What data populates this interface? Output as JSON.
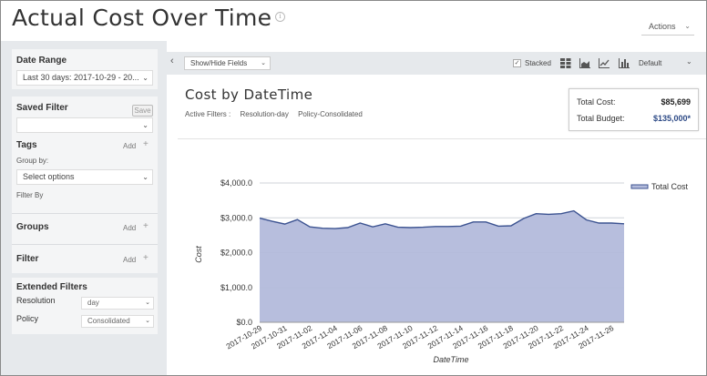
{
  "header": {
    "title": "Actual Cost Over Time",
    "actions_label": "Actions"
  },
  "sidebar": {
    "date_range": {
      "title": "Date Range",
      "value": "Last 30 days:  2017-10-29 - 20..."
    },
    "saved_filter": {
      "title": "Saved Filter",
      "save_label": "Save",
      "value": ""
    },
    "tags": {
      "title": "Tags",
      "add_label": "Add",
      "group_by_label": "Group by:",
      "select_placeholder": "Select options",
      "filter_by_label": "Filter By"
    },
    "groups": {
      "title": "Groups",
      "add_label": "Add"
    },
    "filter": {
      "title": "Filter",
      "add_label": "Add"
    },
    "extended_filters": {
      "title": "Extended Filters",
      "resolution_label": "Resolution",
      "resolution_value": "day",
      "policy_label": "Policy",
      "policy_value": "Consolidated"
    }
  },
  "toolbar": {
    "show_hide_label": "Show/Hide Fields",
    "stacked_label": "Stacked",
    "stacked_checked": true,
    "default_label": "Default"
  },
  "main": {
    "chart_title": "Cost by DateTime",
    "active_filters_label": "Active Filters :",
    "active_filters": [
      "Resolution-day",
      "Policy-Consolidated"
    ],
    "totals": {
      "cost_label": "Total Cost:",
      "cost_value": "$85,699",
      "budget_label": "Total Budget:",
      "budget_value": "$135,000*"
    }
  },
  "colors": {
    "area_fill": "#b3bbdb",
    "area_line": "#3c5391"
  },
  "chart_data": {
    "type": "area",
    "xlabel": "DateTime",
    "ylabel": "Cost",
    "ylim": [
      0,
      4000
    ],
    "yticks": [
      "$0.0",
      "$1,000.0",
      "$2,000.0",
      "$3,000.0",
      "$4,000.0"
    ],
    "grid": true,
    "legend_position": "top-right",
    "x": [
      "2017-10-29",
      "2017-10-30",
      "2017-10-31",
      "2017-11-01",
      "2017-11-02",
      "2017-11-03",
      "2017-11-04",
      "2017-11-05",
      "2017-11-06",
      "2017-11-07",
      "2017-11-08",
      "2017-11-09",
      "2017-11-10",
      "2017-11-11",
      "2017-11-12",
      "2017-11-13",
      "2017-11-14",
      "2017-11-15",
      "2017-11-16",
      "2017-11-17",
      "2017-11-18",
      "2017-11-19",
      "2017-11-20",
      "2017-11-21",
      "2017-11-22",
      "2017-11-23",
      "2017-11-24",
      "2017-11-25",
      "2017-11-26",
      "2017-11-27"
    ],
    "x_tick_labels": [
      "2017-10-29",
      "2017-10-31",
      "2017-11-02",
      "2017-11-04",
      "2017-11-06",
      "2017-11-08",
      "2017-11-10",
      "2017-11-12",
      "2017-11-14",
      "2017-11-16",
      "2017-11-18",
      "2017-11-20",
      "2017-11-22",
      "2017-11-24",
      "2017-11-26"
    ],
    "series": [
      {
        "name": "Total Cost",
        "values": [
          2990,
          2900,
          2820,
          2950,
          2740,
          2700,
          2690,
          2720,
          2850,
          2740,
          2830,
          2730,
          2720,
          2730,
          2750,
          2750,
          2760,
          2880,
          2880,
          2760,
          2770,
          2980,
          3120,
          3100,
          3120,
          3200,
          2940,
          2850,
          2850,
          2830
        ]
      }
    ]
  }
}
